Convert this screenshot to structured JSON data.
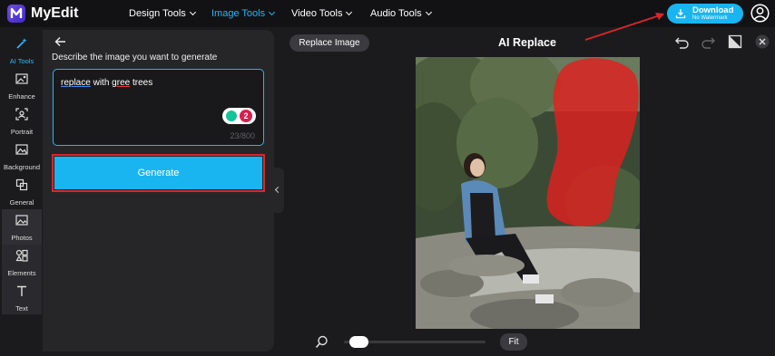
{
  "app": {
    "name": "MyEdit",
    "logo_icon": "myedit-logo-icon"
  },
  "nav": [
    {
      "label": "Design Tools",
      "active": false
    },
    {
      "label": "Image Tools",
      "active": true
    },
    {
      "label": "Video Tools",
      "active": false
    },
    {
      "label": "Audio Tools",
      "active": false
    }
  ],
  "download": {
    "title": "Download",
    "subtitle": "No Watermark"
  },
  "colors": {
    "accent": "#19b5f0",
    "highlight_red": "#d9262b",
    "mask_red": "#e02020"
  },
  "rail": [
    {
      "label": "AI Tools",
      "icon": "magic-wand-icon",
      "active": true
    },
    {
      "label": "Enhance",
      "icon": "enhance-icon"
    },
    {
      "label": "Portrait",
      "icon": "portrait-icon"
    },
    {
      "label": "Background",
      "icon": "background-icon"
    },
    {
      "label": "General",
      "icon": "crop-icon"
    },
    {
      "label": "Photos",
      "icon": "photos-icon"
    },
    {
      "label": "Elements",
      "icon": "elements-icon"
    },
    {
      "label": "Text",
      "icon": "text-icon"
    }
  ],
  "panel": {
    "prompt_label": "Describe the image you want to generate",
    "prompt_words": [
      "replace",
      "with",
      "gree",
      "trees"
    ],
    "char_count": "23/800",
    "grammarly_count": "2",
    "generate_label": "Generate"
  },
  "canvas": {
    "replace_button": "Replace Image",
    "title": "AI Replace",
    "fit_label": "Fit",
    "zoom_level": 0.05
  }
}
